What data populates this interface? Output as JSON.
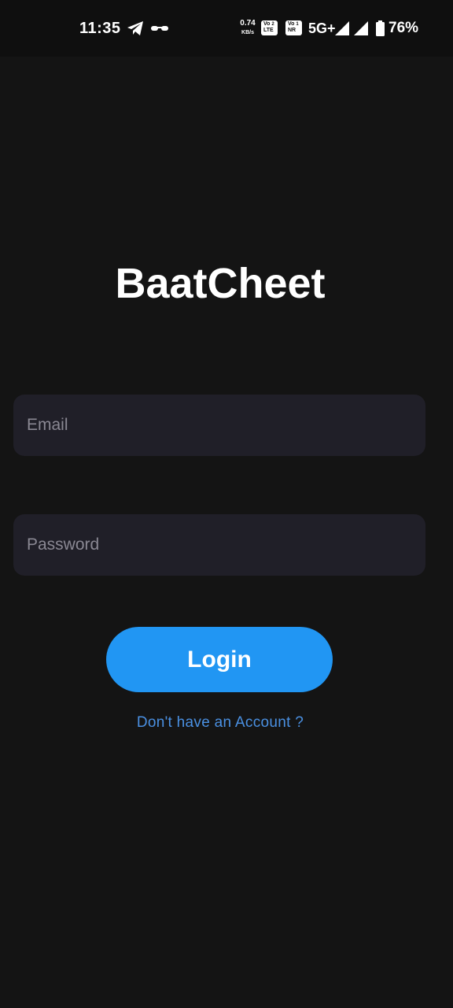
{
  "status_bar": {
    "time": "11:35",
    "notification_icons": [
      "telegram-icon",
      "incognito-icon"
    ],
    "net_speed_value": "0.74",
    "net_speed_unit": "KB/s",
    "sim1_badge_top": "Vo",
    "sim1_badge_sup": "2",
    "sim1_badge_bottom": "LTE",
    "sim2_badge_top": "Vo",
    "sim2_badge_sup": "1",
    "sim2_badge_bottom": "NR",
    "network_type": "5G+",
    "battery_percent": "76%"
  },
  "app": {
    "title": "BaatCheet",
    "email": {
      "placeholder": "Email",
      "value": ""
    },
    "password": {
      "placeholder": "Password",
      "value": ""
    },
    "login_label": "Login",
    "signup_link_label": "Don't have an Account ?"
  },
  "colors": {
    "background": "#141414",
    "status_bar_background": "#0f0f0f",
    "field_background": "#201f28",
    "placeholder": "#8a8893",
    "primary_button": "#2196f3",
    "link": "#4a90e2",
    "text": "#ffffff"
  }
}
